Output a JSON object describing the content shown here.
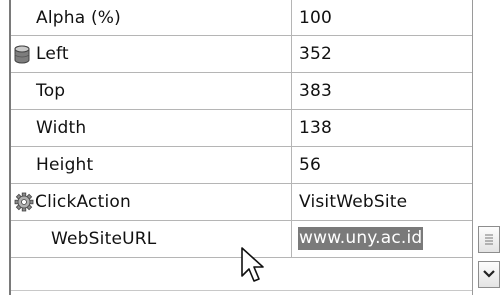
{
  "properties": [
    {
      "name": "Alpha (%)",
      "value": "100",
      "icon": ""
    },
    {
      "name": "Left",
      "value": "352",
      "icon": "database-cylinder-icon"
    },
    {
      "name": "Top",
      "value": "383",
      "icon": ""
    },
    {
      "name": "Width",
      "value": "138",
      "icon": ""
    },
    {
      "name": "Height",
      "value": "56",
      "icon": ""
    },
    {
      "name": "ClickAction",
      "value": "VisitWebSite",
      "icon": "gear-icon"
    },
    {
      "name": "WebSiteURL",
      "value": "www.uny.ac.id",
      "icon": ""
    }
  ],
  "selected_row": "WebSiteURL",
  "side_buttons": [
    "lines-menu-icon",
    "chevron-down-icon"
  ],
  "colors": {
    "selection": "#7a7a7a",
    "gridline": "#b5b5b5",
    "text": "#111111"
  }
}
